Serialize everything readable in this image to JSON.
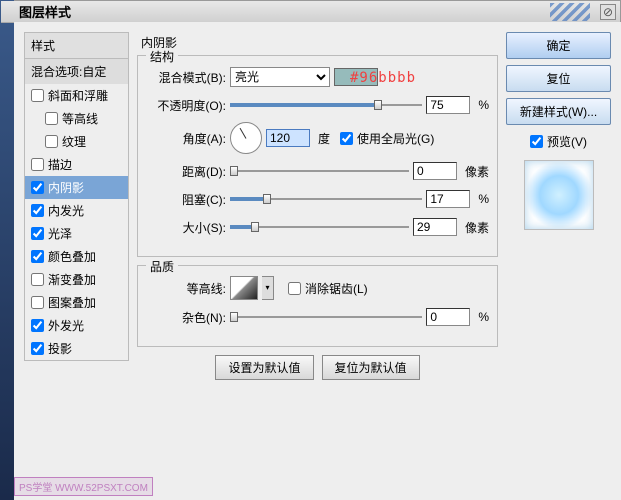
{
  "title": "图层样式",
  "annotation": "#96bbbb",
  "left": {
    "header": "样式",
    "blend": "混合选项:自定",
    "items": [
      {
        "label": "斜面和浮雕",
        "checked": false,
        "indent": false,
        "selected": false
      },
      {
        "label": "等高线",
        "checked": false,
        "indent": true,
        "selected": false
      },
      {
        "label": "纹理",
        "checked": false,
        "indent": true,
        "selected": false
      },
      {
        "label": "描边",
        "checked": false,
        "indent": false,
        "selected": false
      },
      {
        "label": "内阴影",
        "checked": true,
        "indent": false,
        "selected": true
      },
      {
        "label": "内发光",
        "checked": true,
        "indent": false,
        "selected": false
      },
      {
        "label": "光泽",
        "checked": true,
        "indent": false,
        "selected": false
      },
      {
        "label": "颜色叠加",
        "checked": true,
        "indent": false,
        "selected": false
      },
      {
        "label": "渐变叠加",
        "checked": false,
        "indent": false,
        "selected": false
      },
      {
        "label": "图案叠加",
        "checked": false,
        "indent": false,
        "selected": false
      },
      {
        "label": "外发光",
        "checked": true,
        "indent": false,
        "selected": false
      },
      {
        "label": "投影",
        "checked": true,
        "indent": false,
        "selected": false
      }
    ]
  },
  "panel": {
    "title": "内阴影",
    "group1": {
      "label": "结构",
      "blend_lbl": "混合模式(B):",
      "blend_val": "亮光",
      "swatch_color": "#96bbbb",
      "opacity_lbl": "不透明度(O):",
      "opacity_val": "75",
      "opacity_unit": "%",
      "angle_lbl": "角度(A):",
      "angle_val": "120",
      "angle_unit": "度",
      "global_lbl": "使用全局光(G)",
      "global_checked": true,
      "distance_lbl": "距离(D):",
      "distance_val": "0",
      "distance_unit": "像素",
      "choke_lbl": "阻塞(C):",
      "choke_val": "17",
      "choke_unit": "%",
      "size_lbl": "大小(S):",
      "size_val": "29",
      "size_unit": "像素"
    },
    "group2": {
      "label": "品质",
      "contour_lbl": "等高线:",
      "aa_lbl": "消除锯齿(L)",
      "aa_checked": false,
      "noise_lbl": "杂色(N):",
      "noise_val": "0",
      "noise_unit": "%"
    },
    "btn_default": "设置为默认值",
    "btn_reset": "复位为默认值"
  },
  "right": {
    "ok": "确定",
    "cancel": "复位",
    "newstyle": "新建样式(W)...",
    "preview_lbl": "预览(V)",
    "preview_checked": true
  },
  "watermark": "PS学堂  WWW.52PSXT.COM"
}
